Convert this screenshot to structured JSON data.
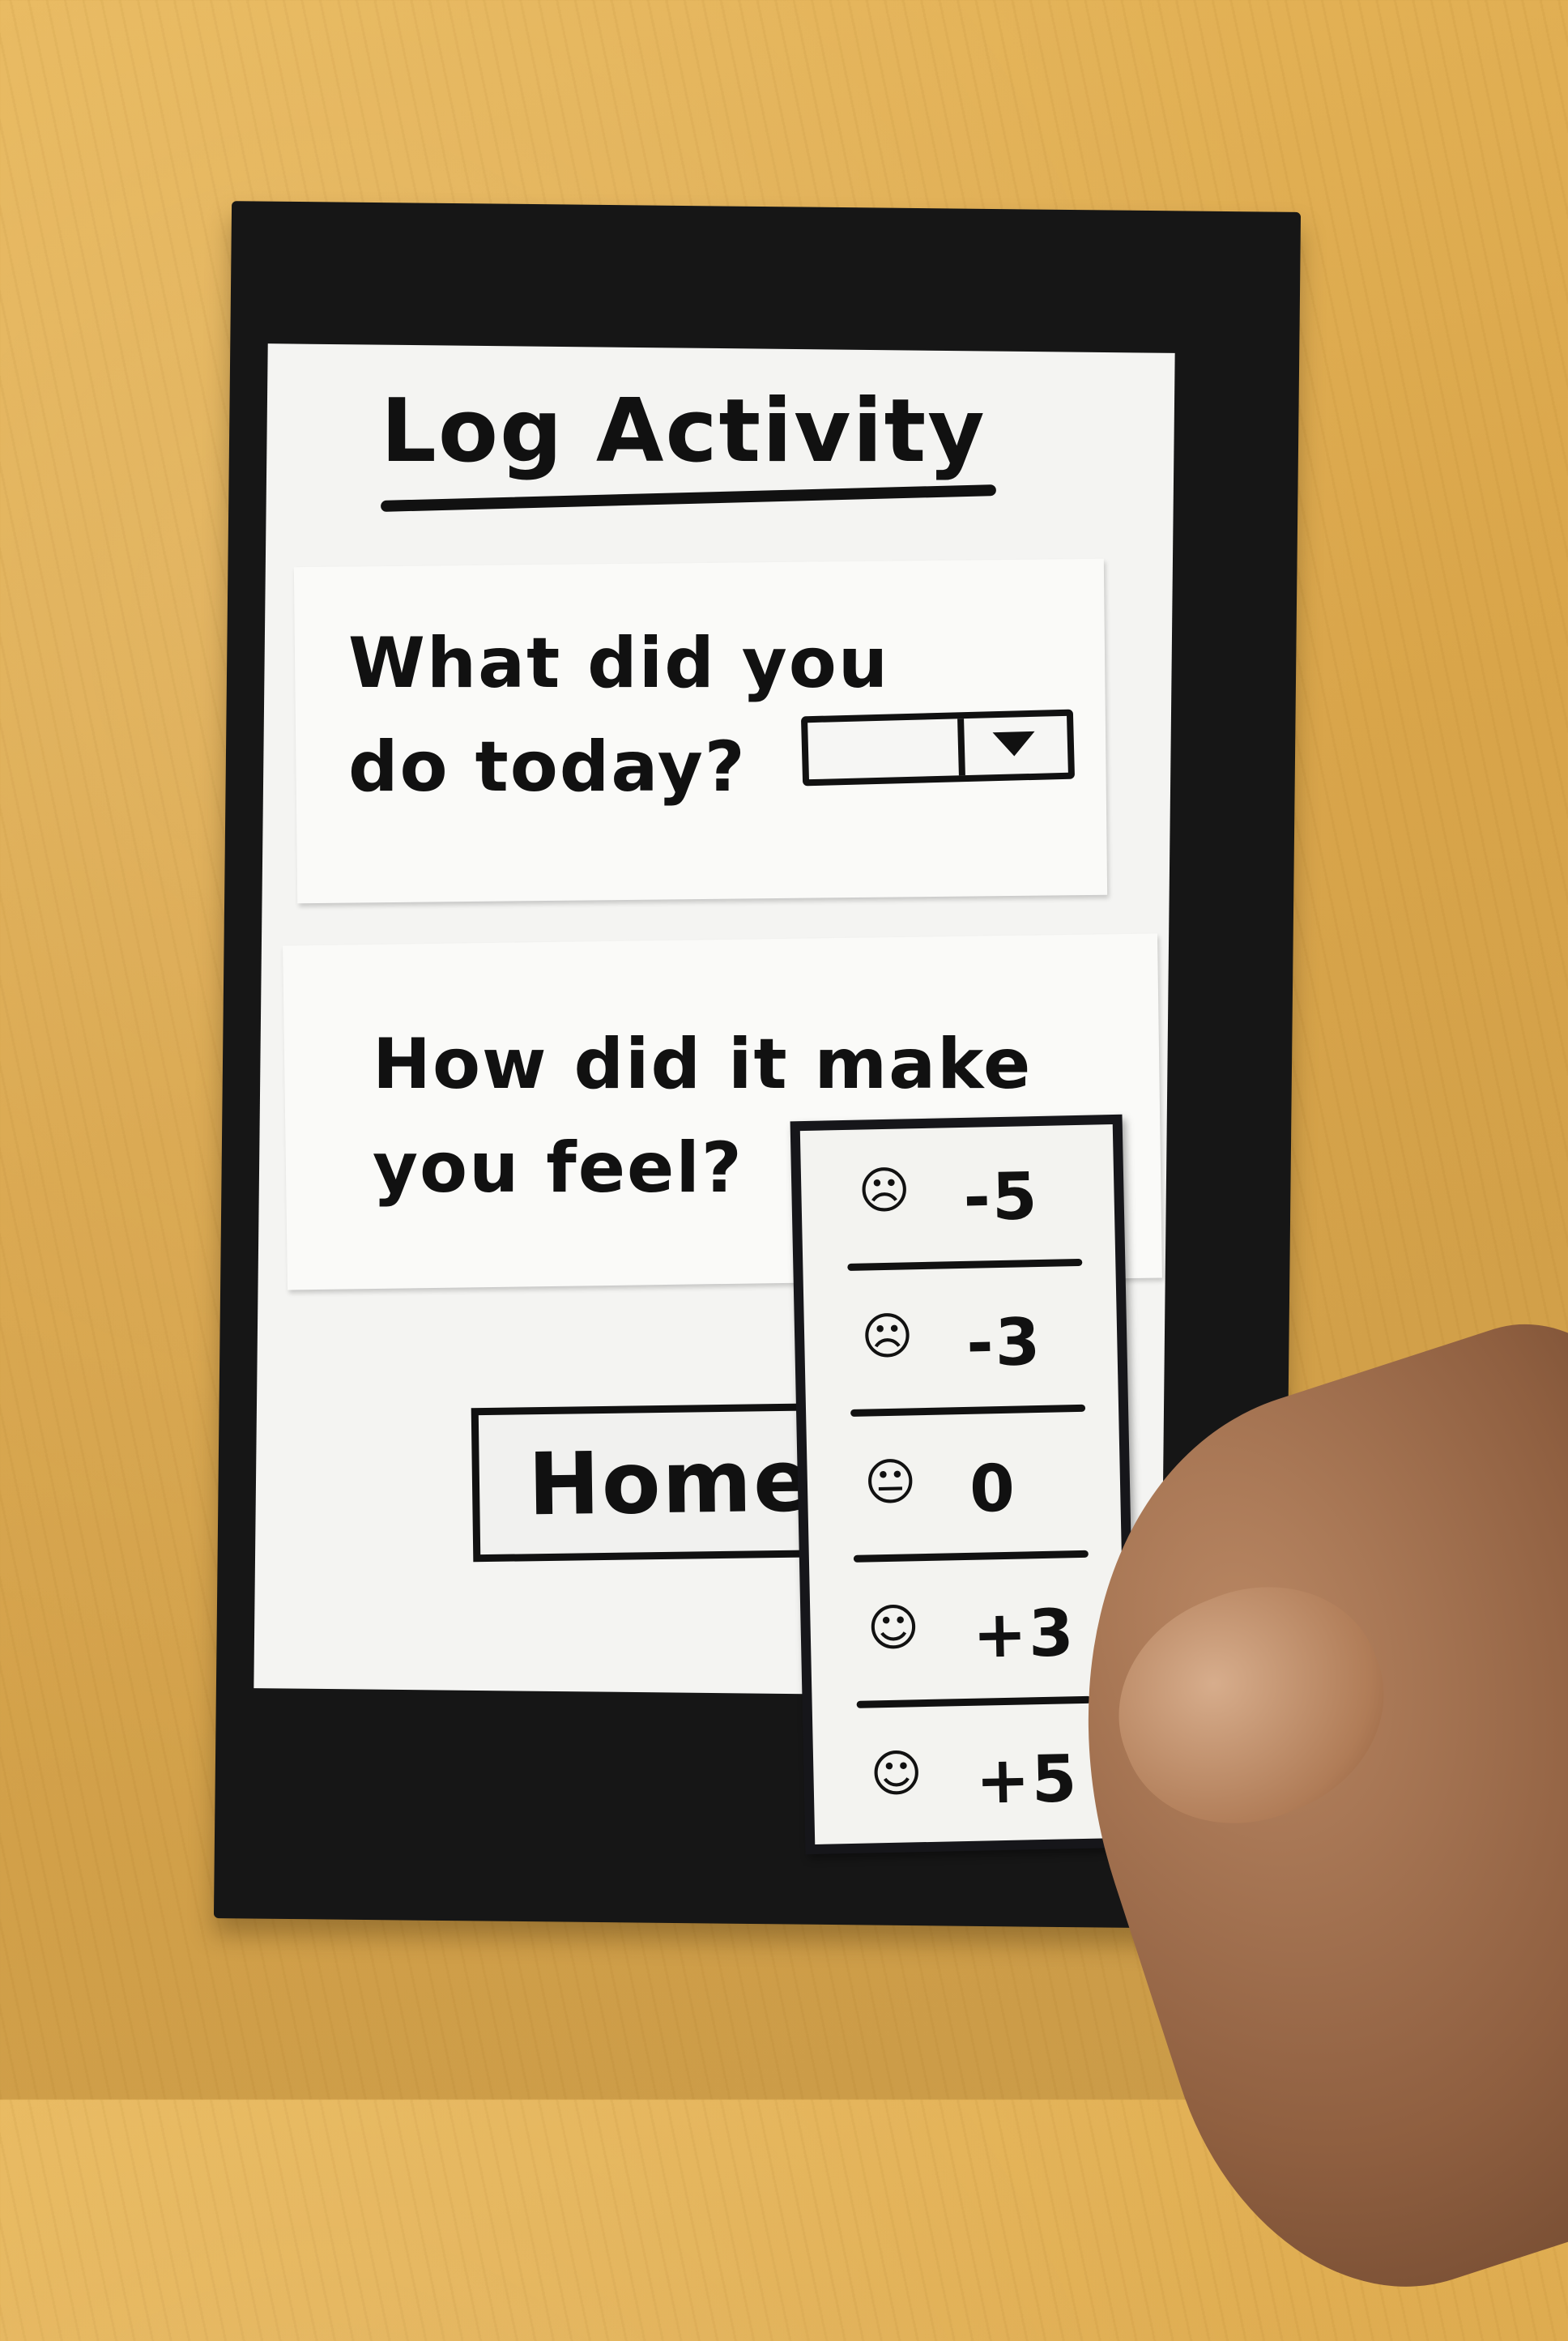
{
  "screen": {
    "title": "Log Activity"
  },
  "activity_question": {
    "label": "What did you do today?",
    "dropdown_value": ""
  },
  "feel_question": {
    "label": "How did it make you feel?"
  },
  "feel_options": [
    {
      "face": "☹",
      "value": "-5"
    },
    {
      "face": "☹",
      "value": "-3"
    },
    {
      "face": "😐",
      "value": "0"
    },
    {
      "face": "☺",
      "value": "+3"
    },
    {
      "face": "☺",
      "value": "+5"
    }
  ],
  "home_button": {
    "label": "Home"
  },
  "colors": {
    "ink": "#111111",
    "paper": "#f4f4f2",
    "phone_frame": "#161616",
    "table_wood": "#d9a54a"
  }
}
